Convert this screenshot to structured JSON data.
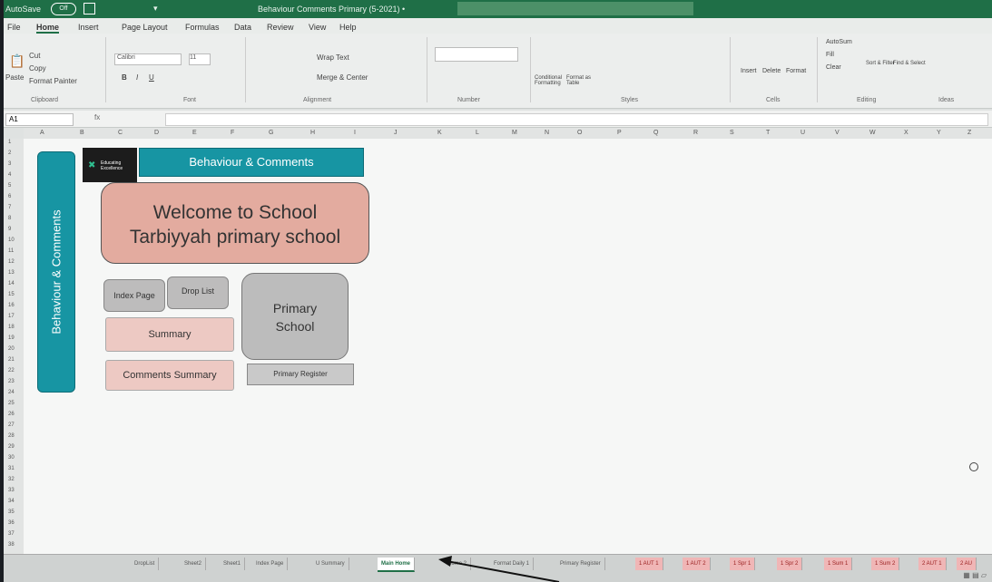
{
  "titlebar": {
    "autosave": "AutoSave",
    "toggle": "Off",
    "doc_title": "Behaviour Comments Primary (5-2021) •"
  },
  "menu": [
    "File",
    "Home",
    "Insert",
    "Page Layout",
    "Formulas",
    "Data",
    "Review",
    "View",
    "Help"
  ],
  "ribbon": {
    "clipboard": {
      "paste": "Paste",
      "cut": "Cut",
      "copy": "Copy",
      "format_painter": "Format Painter",
      "label": "Clipboard"
    },
    "font": {
      "name": "Calibri",
      "size": "11",
      "label": "Font"
    },
    "alignment": {
      "wrap": "Wrap Text",
      "merge": "Merge & Center",
      "label": "Alignment"
    },
    "number": {
      "label": "Number"
    },
    "styles": {
      "conditional": "Conditional Formatting",
      "format_as": "Format as Table",
      "label": "Styles"
    },
    "cells": {
      "insert": "Insert",
      "delete": "Delete",
      "format": "Format",
      "label": "Cells"
    },
    "editing": {
      "autosum": "AutoSum",
      "fill": "Fill",
      "clear": "Clear",
      "sort": "Sort & Filter",
      "find": "Find & Select",
      "label": "Editing"
    },
    "ideas": {
      "label": "Ideas"
    }
  },
  "formula_bar": {
    "name_box": "A1",
    "fx": "fx",
    "value": ""
  },
  "columns": [
    "A",
    "B",
    "C",
    "D",
    "E",
    "F",
    "G",
    "H",
    "I",
    "J",
    "K",
    "L",
    "M",
    "N",
    "O",
    "P",
    "Q",
    "R",
    "S",
    "T",
    "U",
    "V",
    "W",
    "X",
    "Y",
    "Z"
  ],
  "rows": [
    "1",
    "2",
    "3",
    "4",
    "5",
    "6",
    "7",
    "8",
    "9",
    "10",
    "11",
    "12",
    "13",
    "14",
    "15",
    "16",
    "17",
    "18",
    "19",
    "20",
    "21",
    "22",
    "23",
    "24",
    "25",
    "26",
    "27",
    "28",
    "29",
    "30",
    "31",
    "32",
    "33",
    "34",
    "35",
    "36",
    "37",
    "38"
  ],
  "sheet": {
    "side_title": "Behaviour & Comments",
    "logo_text": "Educating Excellence",
    "header": "Behaviour & Comments",
    "welcome_line1": "Welcome to School",
    "welcome_line2": "Tarbiyyah primary school",
    "btn_index": "Index Page",
    "btn_drop": "Drop List",
    "btn_summary": "Summary",
    "btn_comments": "Comments Summary",
    "primary_line1": "Primary",
    "primary_line2": "School",
    "btn_register": "Primary Register"
  },
  "tabs": [
    {
      "label": "DropList",
      "state": "normal"
    },
    {
      "label": "Sheet2",
      "state": "normal"
    },
    {
      "label": "Sheet1",
      "state": "normal"
    },
    {
      "label": "Index Page",
      "state": "normal"
    },
    {
      "label": "U Summary",
      "state": "normal"
    },
    {
      "label": "Main Home",
      "state": "active"
    },
    {
      "label": "Home 2",
      "state": "normal"
    },
    {
      "label": "Format Daily 1",
      "state": "normal"
    },
    {
      "label": "Primary Register",
      "state": "normal"
    },
    {
      "label": "1 AUT 1",
      "state": "red"
    },
    {
      "label": "1 AUT 2",
      "state": "red"
    },
    {
      "label": "1 Spr 1",
      "state": "red"
    },
    {
      "label": "1 Spr 2",
      "state": "red"
    },
    {
      "label": "1 Sum 1",
      "state": "red"
    },
    {
      "label": "1 Sum 2",
      "state": "red"
    },
    {
      "label": "2 AUT 1",
      "state": "red"
    },
    {
      "label": "2 AU",
      "state": "red"
    }
  ]
}
